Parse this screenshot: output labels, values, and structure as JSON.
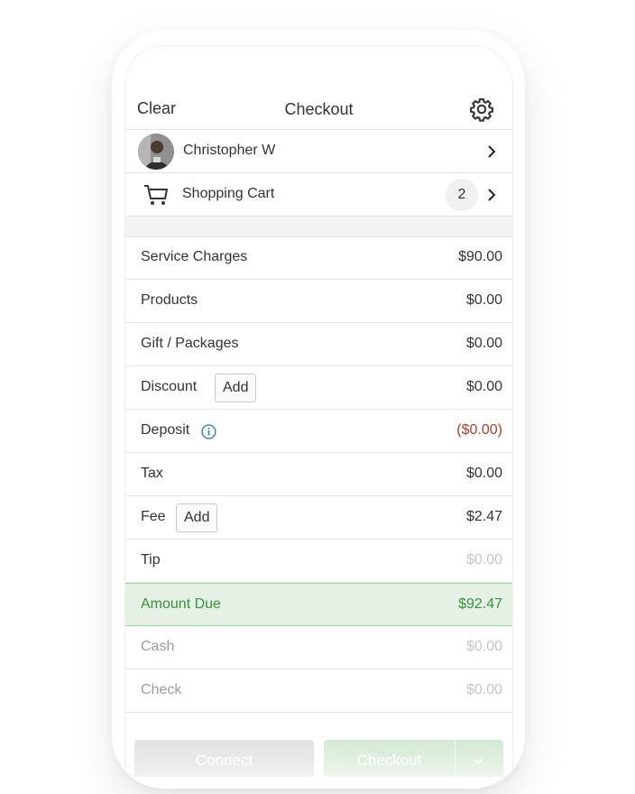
{
  "nav": {
    "clear": "Clear",
    "title": "Checkout"
  },
  "customer": {
    "name": "Christopher W"
  },
  "cart": {
    "label": "Shopping Cart",
    "count": "2"
  },
  "lines": {
    "service": {
      "label": "Service Charges",
      "amount": "$90.00"
    },
    "products": {
      "label": "Products",
      "amount": "$0.00"
    },
    "gift": {
      "label": "Gift / Packages",
      "amount": "$0.00"
    },
    "discount": {
      "label": "Discount",
      "add": "Add",
      "amount": "$0.00"
    },
    "deposit": {
      "label": "Deposit",
      "amount": "($0.00)"
    },
    "tax": {
      "label": "Tax",
      "amount": "$0.00"
    },
    "fee": {
      "label": "Fee",
      "add": "Add",
      "amount": "$2.47"
    },
    "tip": {
      "label": "Tip",
      "amount": "$0.00"
    },
    "due": {
      "label": "Amount Due",
      "amount": "$92.47"
    },
    "cash": {
      "label": "Cash",
      "amount": "$0.00"
    },
    "check": {
      "label": "Check",
      "amount": "$0.00"
    }
  },
  "footer": {
    "connect": "Connect",
    "checkout": "Checkout"
  },
  "colors": {
    "due_green": "#3a8f3a",
    "due_bg": "#e5f1e5",
    "deposit_red": "#b03a2e",
    "info_blue": "#2f80c8"
  }
}
